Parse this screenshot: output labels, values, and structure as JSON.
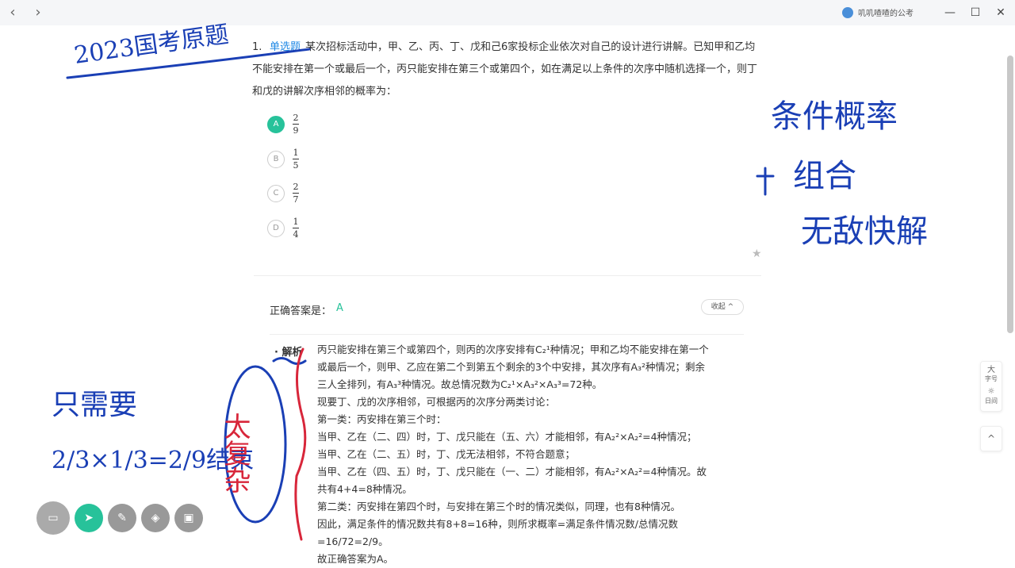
{
  "window": {
    "app_title": "叽叽喳喳的公考",
    "back": "‹",
    "forward": "›",
    "minimize": "—",
    "maximize": "☐",
    "close": "✕"
  },
  "question": {
    "number": "1.",
    "type_tag": "单选题",
    "text": "某次招标活动中，甲、乙、丙、丁、戊和己6家投标企业依次对自己的设计进行讲解。已知甲和乙均不能安排在第一个或最后一个，丙只能安排在第三个或第四个，如在满足以上条件的次序中随机选择一个，则丁和戊的讲解次序相邻的概率为：",
    "options": [
      {
        "letter": "A",
        "num": "2",
        "den": "9",
        "selected": true
      },
      {
        "letter": "B",
        "num": "1",
        "den": "5",
        "selected": false
      },
      {
        "letter": "C",
        "num": "2",
        "den": "7",
        "selected": false
      },
      {
        "letter": "D",
        "num": "1",
        "den": "4",
        "selected": false
      }
    ]
  },
  "answer": {
    "label": "正确答案是：",
    "value": "A",
    "collapse": "收起 ^"
  },
  "analysis": {
    "title": "解析",
    "lines": [
      "丙只能安排在第三个或第四个，则丙的次序安排有C₂¹种情况；甲和乙均不能安排在第一个",
      "或最后一个，则甲、乙应在第二个到第五个剩余的3个中安排，其次序有A₃²种情况；剩余",
      "三人全排列，有A₃³种情况。故总情况数为C₂¹×A₃²×A₃³=72种。",
      "现要丁、戊的次序相邻，可根据丙的次序分两类讨论：",
      "第一类：丙安排在第三个时：",
      "当甲、乙在（二、四）时，丁、戊只能在（五、六）才能相邻，有A₂²×A₂²=4种情况；",
      "当甲、乙在（二、五）时，丁、戊无法相邻，不符合题意；",
      "当甲、乙在（四、五）时，丁、戊只能在（一、二）才能相邻，有A₂²×A₂²=4种情况。故",
      "共有4+4=8种情况。",
      "第二类：丙安排在第四个时，与安排在第三个时的情况类似，同理，也有8种情况。",
      "因此，满足条件的情况数共有8+8=16种，则所求概率=满足条件情况数/总情况数=16/72=2/9。",
      "故正确答案为A。"
    ]
  },
  "sidebar": {
    "font_label": "大",
    "font_sub": "字号",
    "theme_icon": "☼",
    "theme_label": "日间",
    "top_icon": "^"
  },
  "toolbar": {
    "tools": [
      "screen",
      "pointer",
      "pen",
      "eraser",
      "whiteboard"
    ]
  },
  "handwriting": {
    "year_note": "2023国考原题",
    "method_1": "条件概率",
    "method_2": "组合",
    "method_3": "无敌快解",
    "only_need": "只需要",
    "calc": "2/3×1/3=2/9结束",
    "comment": "太复杂"
  },
  "colors": {
    "accent": "#27c29a",
    "tag_blue": "#1e88e5",
    "ink_blue": "#1a3fb5",
    "ink_red": "#d8263a"
  }
}
